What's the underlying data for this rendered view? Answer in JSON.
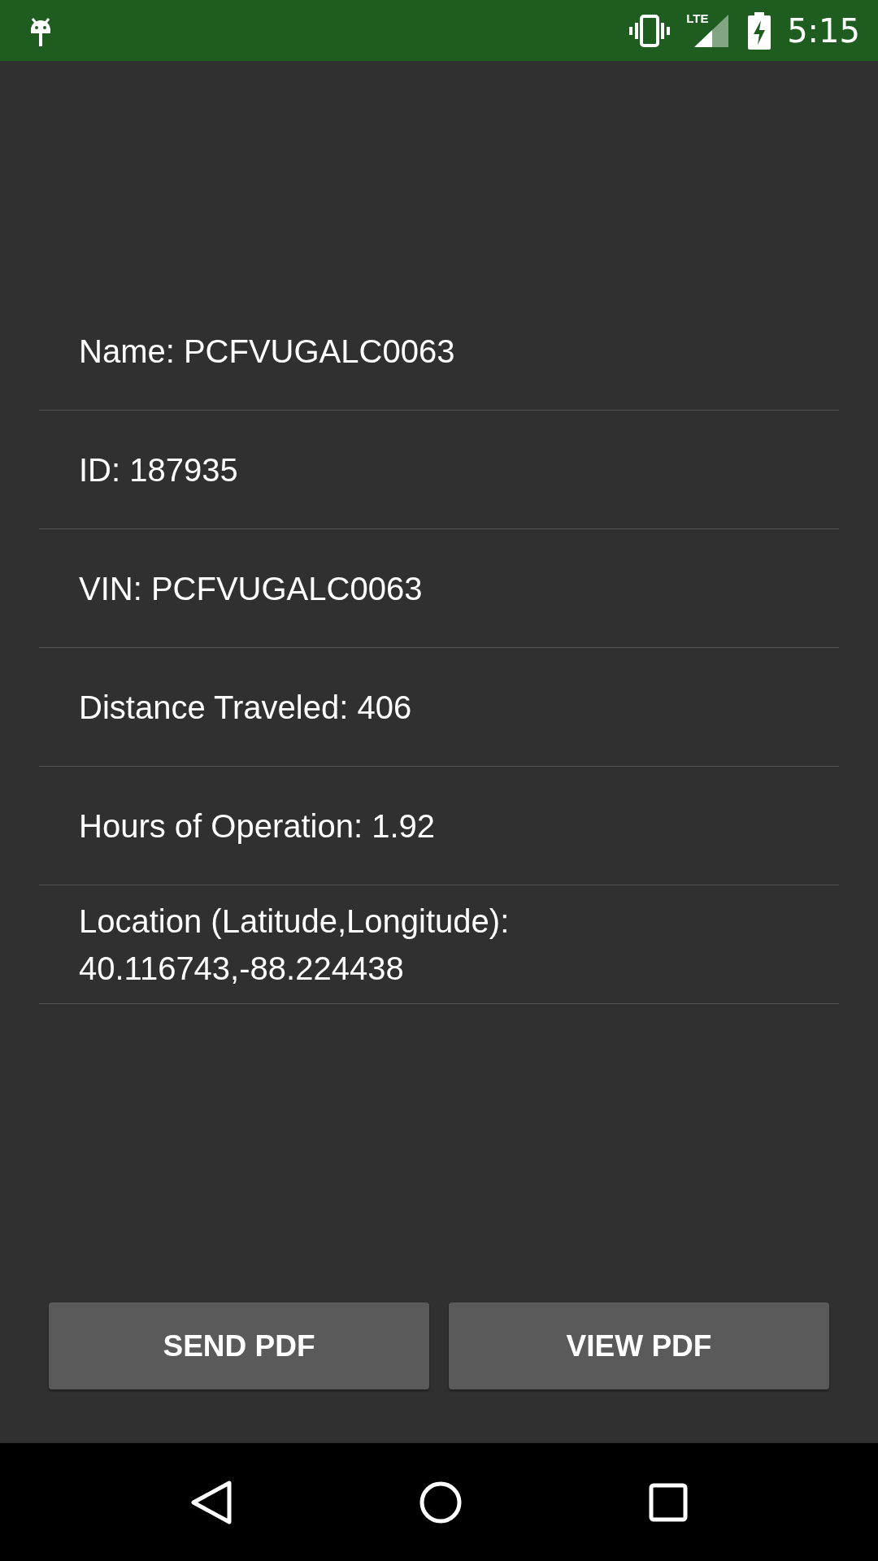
{
  "status_bar": {
    "network": "LTE",
    "time": "5:15"
  },
  "details": [
    "Name: PCFVUGALC0063",
    "ID: 187935",
    "VIN: PCFVUGALC0063",
    "Distance Traveled: 406",
    "Hours of Operation: 1.92",
    "Location (Latitude,Longitude): 40.116743,-88.224438"
  ],
  "buttons": [
    "SEND PDF",
    "VIEW PDF"
  ]
}
